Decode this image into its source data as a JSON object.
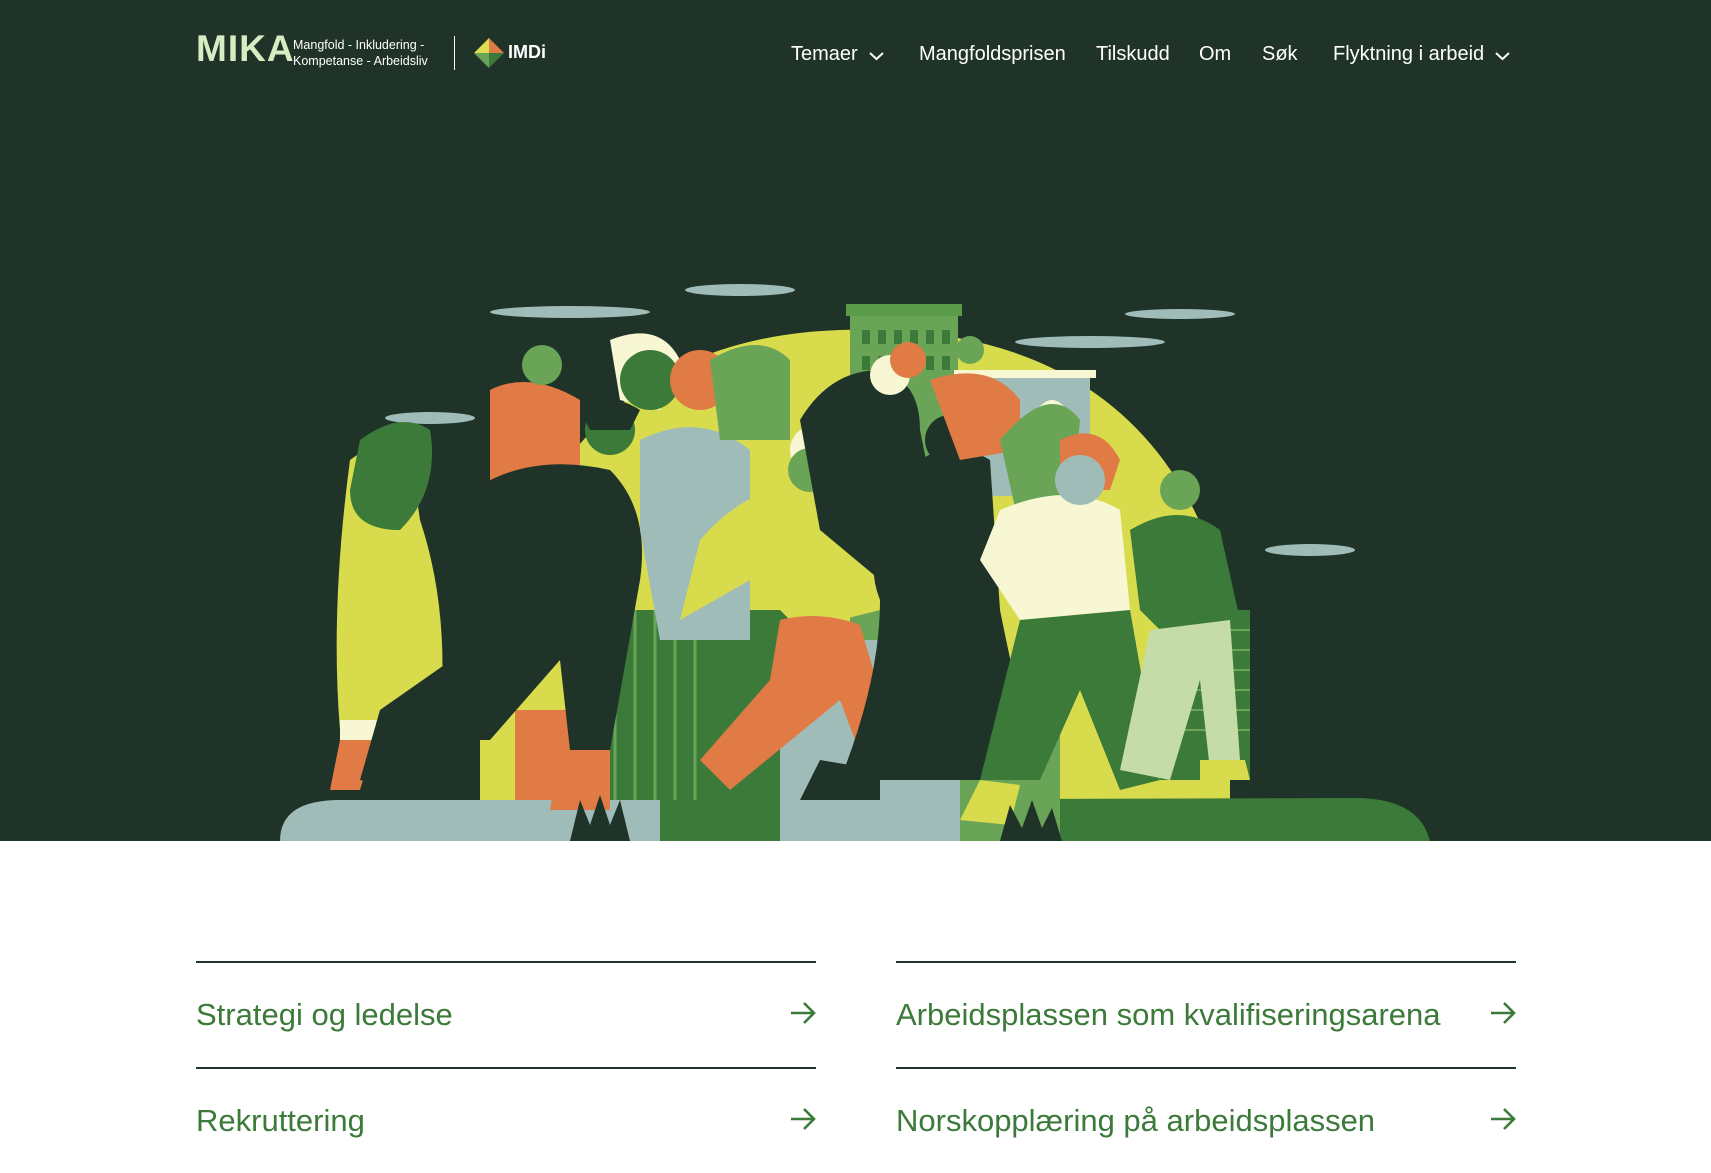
{
  "brand": {
    "name": "MIKA",
    "tagline_line1": "Mangfold - Inkludering -",
    "tagline_line2": "Kompetanse - Arbeidsliv",
    "partner": "IMDi",
    "colors": {
      "background": "#1f3328",
      "accent_green": "#3c7a3a",
      "logo_text": "#d7ecc2"
    }
  },
  "nav": {
    "items": [
      {
        "label": "Temaer",
        "has_dropdown": true
      },
      {
        "label": "Mangfoldsprisen",
        "has_dropdown": false
      },
      {
        "label": "Tilskudd",
        "has_dropdown": false
      },
      {
        "label": "Om",
        "has_dropdown": false
      },
      {
        "label": "Søk",
        "has_dropdown": false
      },
      {
        "label": "Flyktning i arbeid",
        "has_dropdown": true
      }
    ]
  },
  "hero": {
    "illustration": "crowd-of-people-walking-illustration"
  },
  "topics": {
    "left": [
      {
        "label": "Strategi og ledelse",
        "icon": "arrow-right-icon"
      },
      {
        "label": "Rekruttering",
        "icon": "arrow-right-icon"
      }
    ],
    "right": [
      {
        "label": "Arbeidsplassen som kvalifiseringsarena",
        "icon": "arrow-right-icon"
      },
      {
        "label": "Norskopplæring på arbeidsplassen",
        "icon": "arrow-right-icon"
      }
    ]
  }
}
